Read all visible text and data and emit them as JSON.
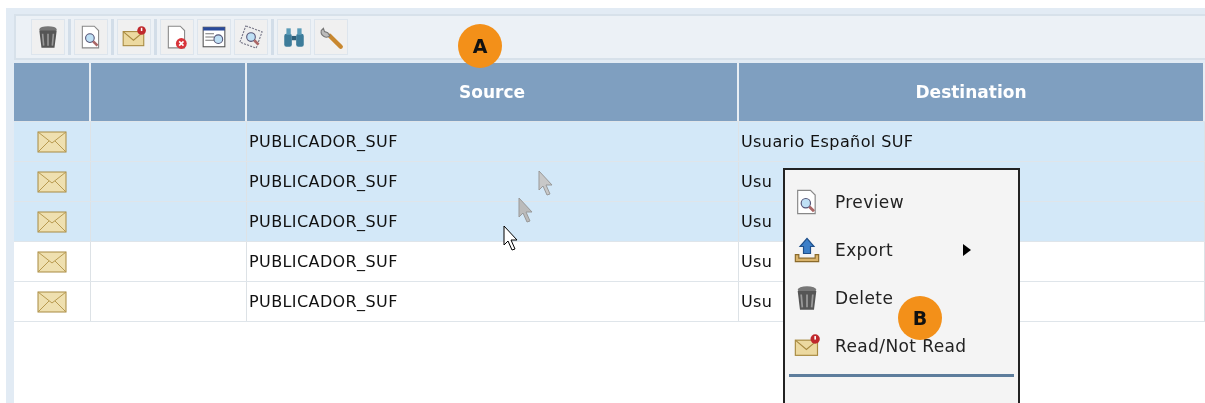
{
  "toolbar": {
    "groups": [
      [
        {
          "kind": "trash"
        }
      ],
      [
        {
          "kind": "preview"
        }
      ],
      [
        {
          "kind": "mail-alert"
        }
      ],
      [
        {
          "kind": "doc-delete"
        },
        {
          "kind": "window-search"
        },
        {
          "kind": "stamp-search"
        }
      ],
      [
        {
          "kind": "binoculars"
        },
        {
          "kind": "wrench"
        }
      ]
    ]
  },
  "table": {
    "columns": [
      {},
      {},
      {
        "label": "Source"
      },
      {
        "label": "Destination"
      }
    ],
    "rows": [
      {
        "selected": true,
        "source": "PUBLICADOR_SUF",
        "destination": "Usuario Español SUF"
      },
      {
        "selected": true,
        "source": "PUBLICADOR_SUF",
        "destination": "Usu"
      },
      {
        "selected": true,
        "source": "PUBLICADOR_SUF",
        "destination": "Usu"
      },
      {
        "selected": false,
        "source": "PUBLICADOR_SUF",
        "destination": "Usu"
      },
      {
        "selected": false,
        "source": "PUBLICADOR_SUF",
        "destination": "Usu"
      }
    ]
  },
  "context_menu": {
    "items": [
      {
        "kind": "preview",
        "label": "Preview",
        "submenu": false
      },
      {
        "kind": "export",
        "label": "Export",
        "submenu": true
      },
      {
        "kind": "trash",
        "label": "Delete",
        "submenu": false
      },
      {
        "kind": "mail-alert",
        "label": "Read/Not Read",
        "submenu": false
      },
      {
        "kind": "separator"
      }
    ]
  },
  "callouts": [
    {
      "label": "A"
    },
    {
      "label": "B"
    }
  ]
}
